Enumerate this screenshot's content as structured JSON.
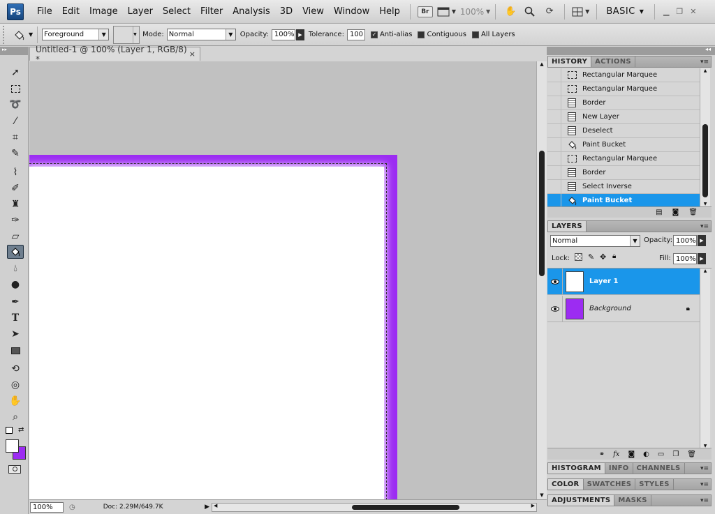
{
  "app": {
    "logo": "Ps"
  },
  "menu": [
    "File",
    "Edit",
    "Image",
    "Layer",
    "Select",
    "Filter",
    "Analysis",
    "3D",
    "View",
    "Window",
    "Help"
  ],
  "appbar": {
    "bridge_label": "Br",
    "zoom_level": "100%",
    "workspace": "BASIC",
    "icons": [
      "screen-mode-icon",
      "hand-icon",
      "zoom-icon",
      "rotate-view-icon",
      "arrange-documents-icon"
    ]
  },
  "options": {
    "fill_source": "Foreground",
    "mode_label": "Mode:",
    "mode_value": "Normal",
    "opacity_label": "Opacity:",
    "opacity_value": "100%",
    "tolerance_label": "Tolerance:",
    "tolerance_value": "100",
    "anti_alias_label": "Anti-alias",
    "contiguous_label": "Contiguous",
    "all_layers_label": "All Layers"
  },
  "document": {
    "tab_title": "Untitled-1 @ 100% (Layer 1, RGB/8) *",
    "close_glyph": "×",
    "zoom": "100%",
    "doc_info": "Doc: 2.29M/649.7K",
    "border_color": "#9c2cf2"
  },
  "history": {
    "tabs": [
      "HISTORY",
      "ACTIONS"
    ],
    "items": [
      {
        "label": "Rectangular Marquee",
        "icon": "marquee-icon"
      },
      {
        "label": "Rectangular Marquee",
        "icon": "marquee-icon"
      },
      {
        "label": "Border",
        "icon": "document-icon"
      },
      {
        "label": "New Layer",
        "icon": "document-icon"
      },
      {
        "label": "Deselect",
        "icon": "document-icon"
      },
      {
        "label": "Paint Bucket",
        "icon": "paint-bucket-icon"
      },
      {
        "label": "Rectangular Marquee",
        "icon": "marquee-icon"
      },
      {
        "label": "Border",
        "icon": "document-icon"
      },
      {
        "label": "Select Inverse",
        "icon": "document-icon"
      },
      {
        "label": "Paint Bucket",
        "icon": "paint-bucket-icon"
      }
    ],
    "selected_index": 9
  },
  "layers": {
    "tab": "LAYERS",
    "blend_mode": "Normal",
    "opacity_label": "Opacity:",
    "opacity_value": "100%",
    "lock_label": "Lock:",
    "fill_label": "Fill:",
    "fill_value": "100%",
    "items": [
      {
        "name": "Layer 1",
        "thumb_color": "#ffffff",
        "selected": true
      },
      {
        "name": "Background",
        "thumb_color": "#9c2cf2",
        "selected": false,
        "locked": true
      }
    ]
  },
  "collapsed_panels": [
    [
      "HISTOGRAM",
      "INFO",
      "CHANNELS"
    ],
    [
      "COLOR",
      "SWATCHES",
      "STYLES"
    ],
    [
      "ADJUSTMENTS",
      "MASKS"
    ]
  ],
  "colors": {
    "foreground": "#ffffff",
    "background": "#9c2cf2",
    "selection_blue": "#1a96ea"
  }
}
